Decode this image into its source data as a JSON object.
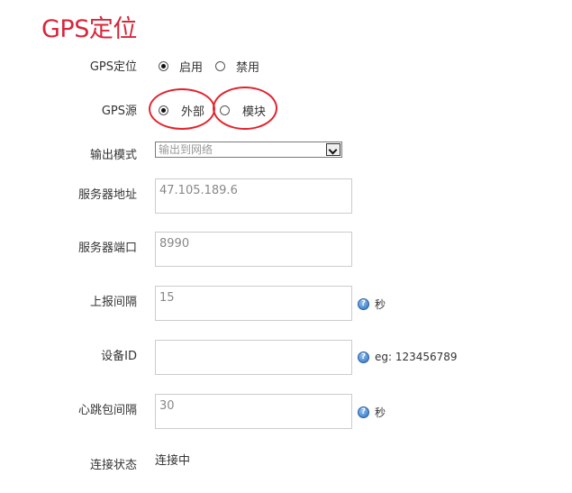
{
  "page_title": "GPS定位",
  "gps_enable": {
    "label": "GPS定位",
    "options": [
      {
        "label": "启用",
        "checked": true
      },
      {
        "label": "禁用",
        "checked": false
      }
    ]
  },
  "gps_source": {
    "label": "GPS源",
    "options": [
      {
        "label": "外部",
        "checked": true
      },
      {
        "label": "模块",
        "checked": false
      }
    ]
  },
  "output_mode": {
    "label": "输出模式",
    "value": "输出到网络"
  },
  "server_address": {
    "label": "服务器地址",
    "value": "47.105.189.6"
  },
  "server_port": {
    "label": "服务器端口",
    "value": "8990"
  },
  "report_interval": {
    "label": "上报间隔",
    "value": "15",
    "hint": "秒"
  },
  "device_id": {
    "label": "设备ID",
    "value": "",
    "hint": "eg: 123456789"
  },
  "heartbeat_interval": {
    "label": "心跳包间隔",
    "value": "30",
    "hint": "秒"
  },
  "connection_status": {
    "label": "连接状态",
    "value": "连接中"
  },
  "colors": {
    "title": "#d9263a",
    "annotation_ring": "#e3232d"
  }
}
